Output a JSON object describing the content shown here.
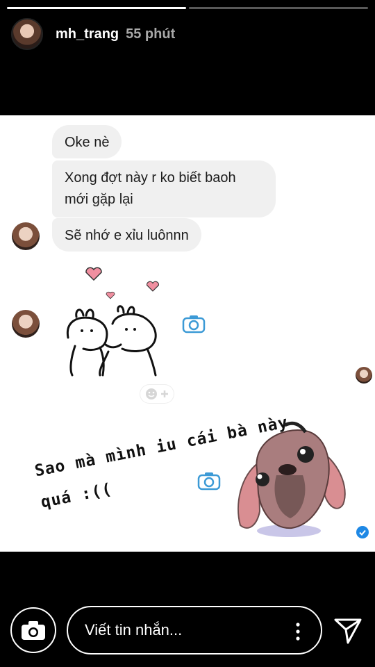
{
  "story": {
    "progress": [
      1.0,
      0.0
    ],
    "username": "mh_trang",
    "time_ago": "55 phút"
  },
  "chat": {
    "messages": [
      {
        "text": "Oke nè"
      },
      {
        "text_line1": "Xong đợt này r ko biết baoh",
        "text_line2": "mới gặp lại"
      },
      {
        "text": "Sẽ nhớ e xỉu luônnn"
      }
    ],
    "handwriting_line1": "Sao mà mình iu cái bà này",
    "handwriting_line2": "quá :(("
  },
  "composer": {
    "placeholder": "Viết tin nhắn..."
  },
  "icons": {
    "camera": "camera-icon",
    "more": "more-vertical-icon",
    "send": "send-icon"
  },
  "colors": {
    "bubble": "#f0f0f0",
    "accent": "#1e88e5",
    "camera_icon": "#3c9ad6"
  }
}
